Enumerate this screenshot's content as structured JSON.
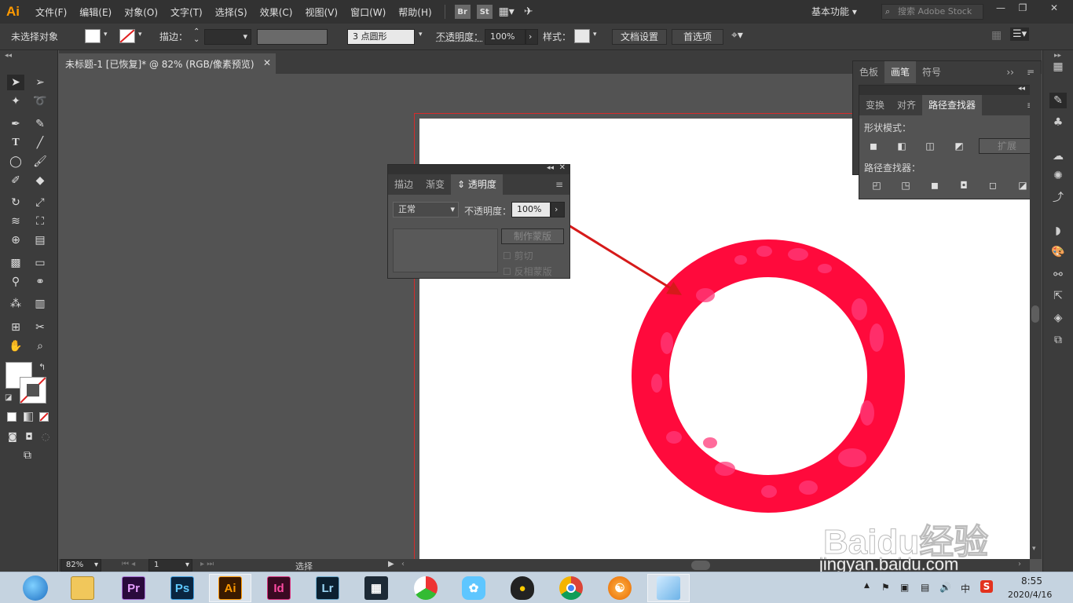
{
  "app": {
    "logo": "Ai",
    "menu": [
      "文件(F)",
      "编辑(E)",
      "对象(O)",
      "文字(T)",
      "选择(S)",
      "效果(C)",
      "视图(V)",
      "窗口(W)",
      "帮助(H)"
    ],
    "bridge_label": "Br",
    "stock_label": "St",
    "workspace": "基本功能",
    "search_placeholder": "搜索 Adobe Stock"
  },
  "control_bar": {
    "selection": "未选择对象",
    "stroke_label": "描边：",
    "brush": "3 点圆形",
    "opacity_label": "不透明度：",
    "opacity_value": "100%",
    "style_label": "样式：",
    "doc_setup": "文档设置",
    "prefs": "首选项"
  },
  "document": {
    "tab_title": "未标题-1 [已恢复]* @ 82% (RGB/像素预览)"
  },
  "status_bar": {
    "zoom": "82%",
    "page": "1",
    "tool": "选择"
  },
  "transparency_panel": {
    "tabs": [
      "描边",
      "渐变",
      "透明度"
    ],
    "blend_mode": "正常",
    "opacity_label": "不透明度：",
    "opacity_value": "100%",
    "make_mask": "制作蒙版",
    "clip": "剪切",
    "invert": "反相蒙版"
  },
  "top_panel": {
    "tabs": [
      "色板",
      "画笔",
      "符号"
    ]
  },
  "pathfinder_panel": {
    "tabs": [
      "变换",
      "对齐",
      "路径查找器"
    ],
    "shape_modes": "形状模式：",
    "expand": "扩展",
    "pathfinders": "路径查找器："
  },
  "watermark": {
    "brand": "Baidu经验",
    "url": "jingyan.baidu.com"
  },
  "taskbar": {
    "apps": [
      "Pr",
      "Ps",
      "Ai",
      "Id",
      "Lr"
    ],
    "time": "8:55",
    "date": "2020/4/16",
    "ime": "中"
  },
  "colors": {
    "ring": "#ff0a3c",
    "ring_spots": "#ff3a7a",
    "arrow": "#d61a1a",
    "ai_brand": "#ff9a00"
  }
}
